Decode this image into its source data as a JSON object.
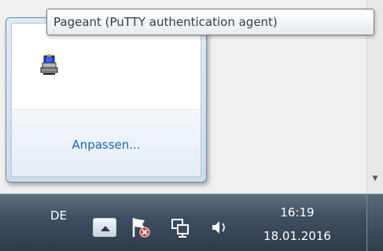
{
  "tooltip": {
    "text": "Pageant (PuTTY authentication agent)"
  },
  "flyout": {
    "customize_label": "Anpassen...",
    "icons": [
      {
        "name": "pageant-icon"
      }
    ]
  },
  "taskbar": {
    "language": "DE",
    "tray_icons": [
      "show-hidden-icons-arrow-icon",
      "action-center-flag-error-icon",
      "network-icon",
      "volume-icon"
    ],
    "clock": {
      "time": "16:19",
      "date": "18.01.2016"
    }
  },
  "colors": {
    "link": "#1a63b8",
    "taskbar": "#3f4f62",
    "flag_error": "#d4322c"
  }
}
